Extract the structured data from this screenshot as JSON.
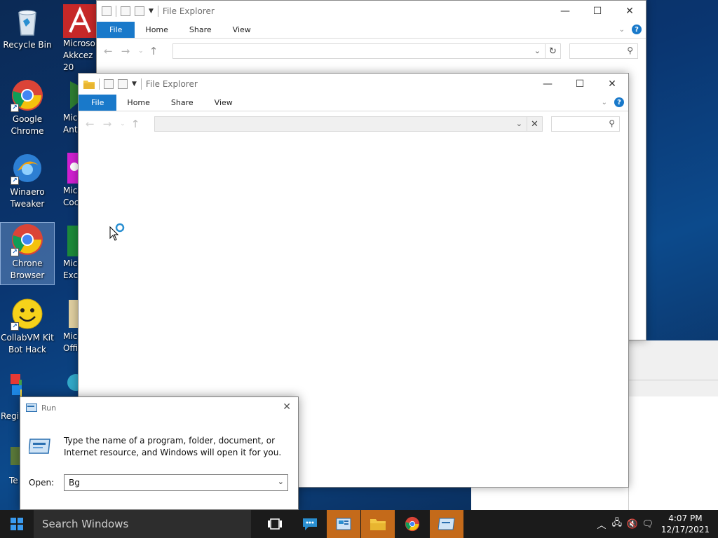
{
  "desktop": {
    "icons": [
      {
        "label": "Recycle Bin"
      },
      {
        "label": "Google Chrome"
      },
      {
        "label": "Winaero Tweaker"
      },
      {
        "label": "Chrone Browser"
      },
      {
        "label": "CollabVM Kit Bot Hack"
      },
      {
        "label": "Regi"
      },
      {
        "label": "Te"
      }
    ],
    "partial_icons": [
      {
        "label": "Microso Akkcez 20"
      },
      {
        "label": "Mic Ant"
      },
      {
        "label": "Micr Cock"
      },
      {
        "label": "Micr Exce"
      },
      {
        "label": "Micr Offi"
      }
    ]
  },
  "explorer_back": {
    "title": "File Explorer",
    "tabs": [
      "File",
      "Home",
      "Share",
      "View"
    ],
    "address": "",
    "search_placeholder": ""
  },
  "explorer_front": {
    "title": "File Explorer",
    "tabs": [
      "File",
      "Home",
      "Share",
      "View"
    ],
    "address": "",
    "search_placeholder": ""
  },
  "run_dialog": {
    "title": "Run",
    "description": "Type the name of a program, folder, document, or Internet resource, and Windows will open it for you.",
    "open_label": "Open:",
    "open_value": "Bg"
  },
  "taskbar": {
    "search_placeholder": "Search Windows",
    "apps": [
      "task-view",
      "feedback",
      "control-panel",
      "file-explorer",
      "chrome",
      "run"
    ],
    "time": "4:07 PM",
    "date": "12/17/2021"
  },
  "colors": {
    "accent": "#1979ca",
    "taskbar": "#1b1b1b",
    "active_app_highlight": "#c46a1a"
  }
}
